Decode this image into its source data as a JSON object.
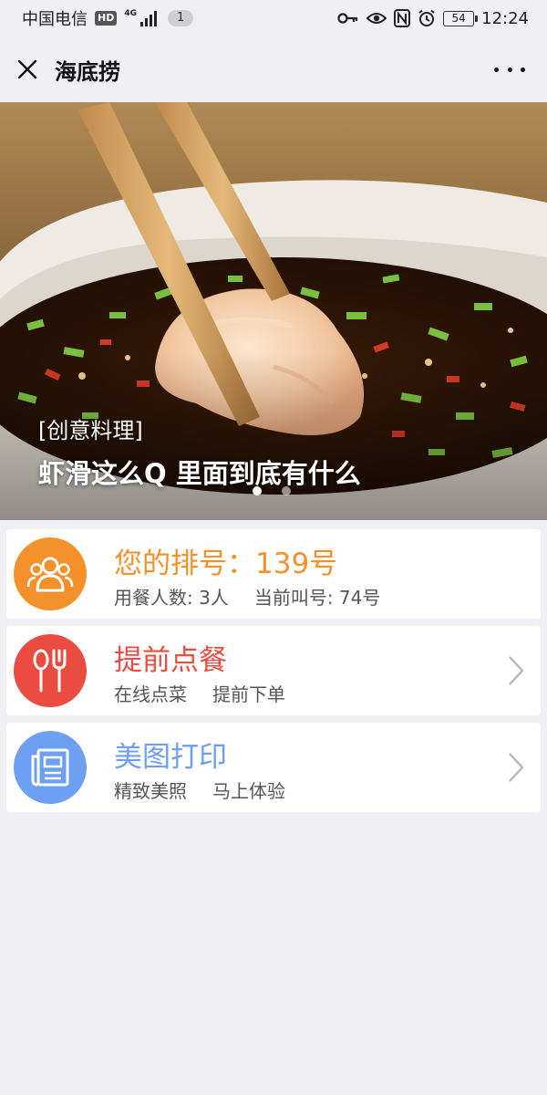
{
  "status_bar": {
    "carrier": "中国电信",
    "hd": "HD",
    "network": "4G",
    "notification_count": "1",
    "battery": "54",
    "time": "12:24"
  },
  "nav": {
    "title": "海底捞",
    "close_icon": "close-icon",
    "more_icon": "more-dots-icon"
  },
  "banner": {
    "tag": "[创意料理]",
    "caption": "虾滑这么Q 里面到底有什么",
    "active_slide": 1,
    "slide_count": 2
  },
  "cards": [
    {
      "icon": "people-icon",
      "color": "#f5912b",
      "title": "您的排号：139号",
      "sub": [
        "用餐人数: 3人",
        "当前叫号: 74号"
      ]
    },
    {
      "icon": "spoon-fork-icon",
      "color": "#ea4c41",
      "title": "提前点餐",
      "sub": [
        "在线点菜",
        "提前下单"
      ]
    },
    {
      "icon": "document-icon",
      "color": "#6e9ff2",
      "title": "美图打印",
      "sub": [
        "精致美照",
        "马上体验"
      ]
    }
  ]
}
